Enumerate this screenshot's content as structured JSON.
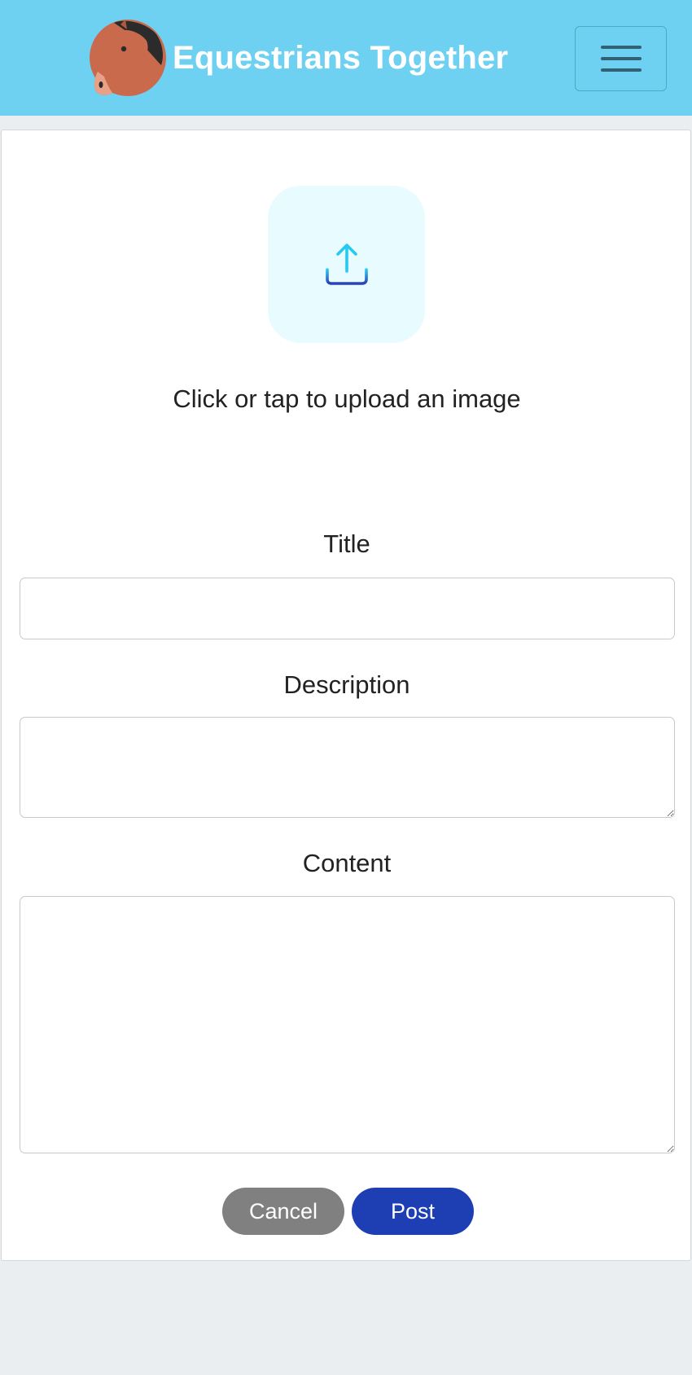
{
  "header": {
    "brand_name": "Equestrians Together",
    "logo_icon": "horse-head-icon",
    "menu_icon": "hamburger-menu-icon",
    "background_color": "#6fd1f2"
  },
  "form": {
    "upload": {
      "icon": "upload-icon",
      "text": "Click or tap to upload an image"
    },
    "title": {
      "label": "Title",
      "value": "",
      "placeholder": ""
    },
    "description": {
      "label": "Description",
      "value": "",
      "placeholder": ""
    },
    "content": {
      "label": "Content",
      "value": "",
      "placeholder": ""
    },
    "actions": {
      "cancel_label": "Cancel",
      "post_label": "Post",
      "cancel_color": "#808080",
      "post_color": "#1e3fb4"
    }
  }
}
